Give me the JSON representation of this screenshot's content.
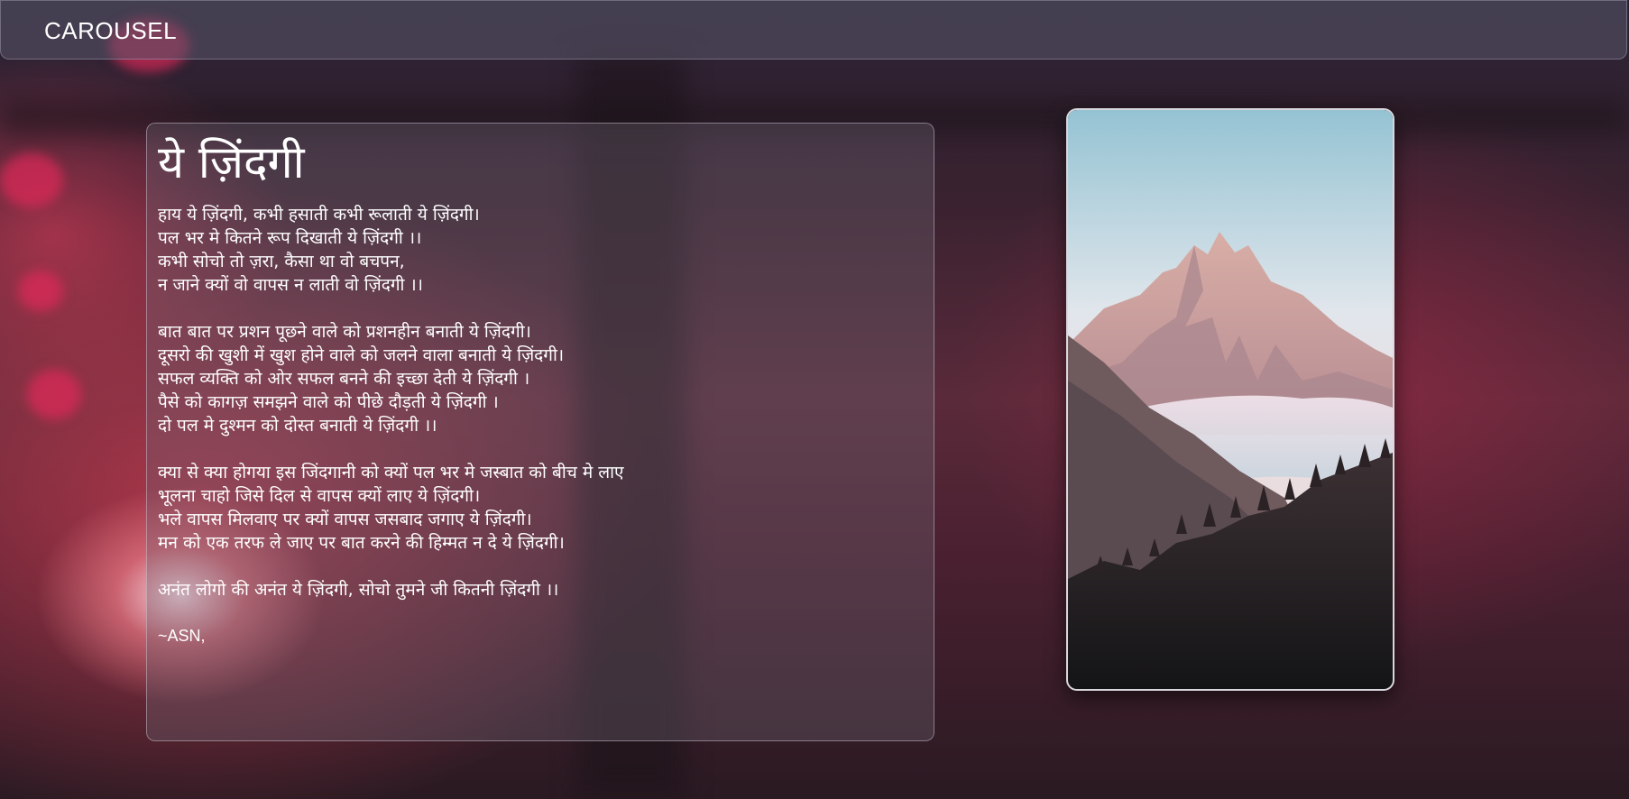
{
  "header": {
    "brand": "CAROUSEL"
  },
  "poem": {
    "title": "ये ज़िंदगी",
    "stanzas": [
      [
        "हाय ये ज़िंदगी, कभी हसाती कभी रूलाती ये ज़िंदगी।",
        "पल भर मे कितने रूप दिखाती ये ज़िंदगी ।।",
        "कभी सोचो तो ज़रा, कैसा था वो बचपन,",
        "न जाने क्यों वो वापस न लाती वो ज़िंदगी ।।"
      ],
      [
        "बात बात पर प्रशन पूछने वाले को प्रशनहीन बनाती ये ज़िंदगी।",
        "दूसरो की खुशी में खुश होने वाले को जलने वाला बनाती ये ज़िंदगी।",
        "सफल व्यक्ति को ओर सफल बनने की इच्छा देती ये ज़िंदगी ।",
        "पैसे को कागज़ समझने वाले को पीछे दौड़ती ये ज़िंदगी ।",
        "दो पल मे दुश्मन को दोस्त बनाती ये ज़िंदगी ।।"
      ],
      [
        "क्या से क्या होगया इस जिंदगानी को क्यों पल भर मे जस्बात को बीच मे लाए",
        "भूलना चाहो जिसे दिल से वापस क्यों लाए ये ज़िंदगी।",
        "भले वापस मिलवाए पर क्यों वापस जसबाद जगाए ये ज़िंदगी।",
        "मन को एक तरफ ले जाए पर बात करने की हिम्मत न दे ये ज़िंदगी।"
      ],
      [
        "अनंत लोगो की अनंत ये ज़िंदगी, सोचो तुमने जी कितनी ज़िंदगी ।।"
      ]
    ],
    "signature": "~ASN,"
  },
  "image": {
    "subject": "mountain-landscape"
  },
  "colors": {
    "card_border": "#e6e1ea",
    "text": "#ffffff",
    "topbar_bg": "#5a5569"
  }
}
